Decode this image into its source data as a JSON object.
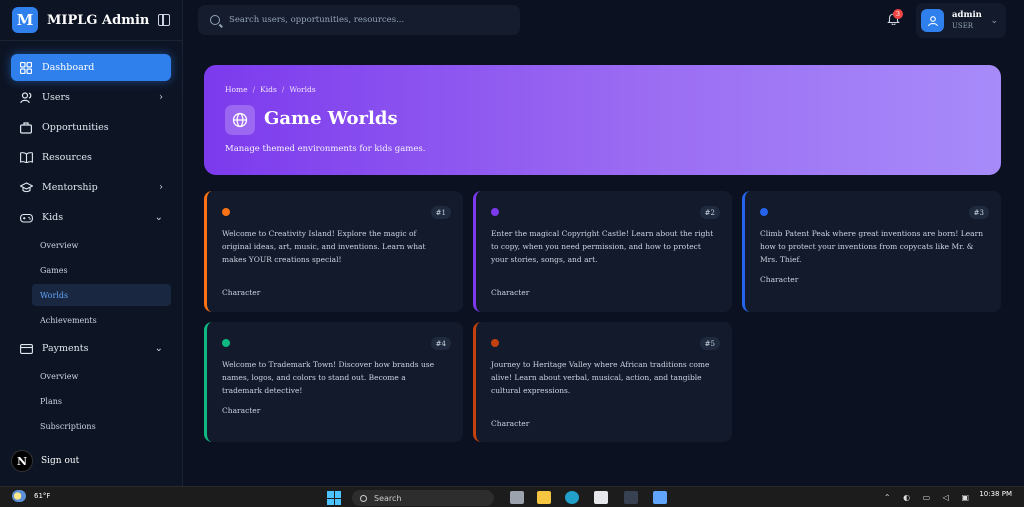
{
  "app": {
    "logo_letter": "M",
    "name": "MIPLG Admin"
  },
  "sidebar": {
    "items": [
      {
        "label": "Dashboard",
        "icon": "grid-icon"
      },
      {
        "label": "Users",
        "icon": "users-icon"
      },
      {
        "label": "Opportunities",
        "icon": "briefcase-icon"
      },
      {
        "label": "Resources",
        "icon": "book-icon"
      },
      {
        "label": "Mentorship",
        "icon": "graduation-cap-icon"
      },
      {
        "label": "Kids",
        "icon": "gamepad-icon"
      },
      {
        "label": "Payments",
        "icon": "credit-card-icon"
      }
    ],
    "kids_sub": [
      "Overview",
      "Games",
      "Worlds",
      "Achievements"
    ],
    "payments_sub": [
      "Overview",
      "Plans",
      "Subscriptions"
    ],
    "signout_badge": "N",
    "signout_label": "Sign out"
  },
  "topbar": {
    "search_placeholder": "Search users, opportunities, resources...",
    "notification_count": "3",
    "user_name": "admin",
    "user_role": "USER"
  },
  "hero": {
    "breadcrumb": [
      "Home",
      "Worlds",
      "Worlds"
    ],
    "crumb_home": "Home",
    "crumb_kids": "Kids",
    "crumb_current": "Worlds",
    "title": "Game Worlds",
    "subtitle": "Manage themed environments for kids games."
  },
  "worlds": [
    {
      "num": "#1",
      "color": "#f97316",
      "description": "Welcome to Creativity Island! Explore the magic of original ideas, art, music, and inventions. Learn what makes YOUR creations special!",
      "tag": "Character"
    },
    {
      "num": "#2",
      "color": "#7c3aed",
      "description": "Enter the magical Copyright Castle! Learn about the right to copy, when you need permission, and how to protect your stories, songs, and art.",
      "tag": "Character"
    },
    {
      "num": "#3",
      "color": "#2563eb",
      "description": "Climb Patent Peak where great inventions are born! Learn how to protect your inventions from copycats like Mr. & Mrs. Thief.",
      "tag": "Character"
    },
    {
      "num": "#4",
      "color": "#10b981",
      "description": "Welcome to Trademark Town! Discover how brands use names, logos, and colors to stand out. Become a trademark detective!",
      "tag": "Character"
    },
    {
      "num": "#5",
      "color": "#c2410c",
      "description": "Journey to Heritage Valley where African traditions come alive! Learn about verbal, musical, action, and tangible cultural expressions.",
      "tag": "Character"
    }
  ],
  "taskbar": {
    "weather": "61°F",
    "search_label": "Search",
    "time": "10:38 PM"
  }
}
